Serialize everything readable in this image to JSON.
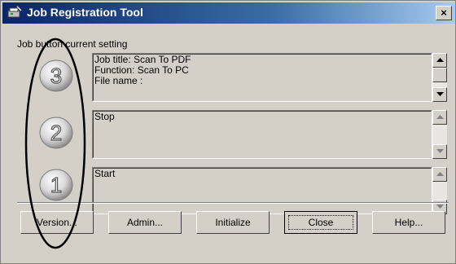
{
  "window": {
    "title": "Job Registration Tool",
    "close_glyph": "×"
  },
  "group_label": "Job button current setting",
  "jobs": [
    {
      "number": "3",
      "text": "Job title: Scan To PDF\nFunction: Scan To PC\nFile name :"
    },
    {
      "number": "2",
      "text": "Stop"
    },
    {
      "number": "1",
      "text": "Start"
    }
  ],
  "buttons": {
    "version": "Version...",
    "admin": "Admin...",
    "initialize": "Initialize",
    "close": "Close",
    "help": "Help..."
  },
  "colors": {
    "face": "#d4d0c8",
    "title_start": "#0a246a",
    "title_end": "#a6caf0",
    "annotation": "#000000"
  }
}
